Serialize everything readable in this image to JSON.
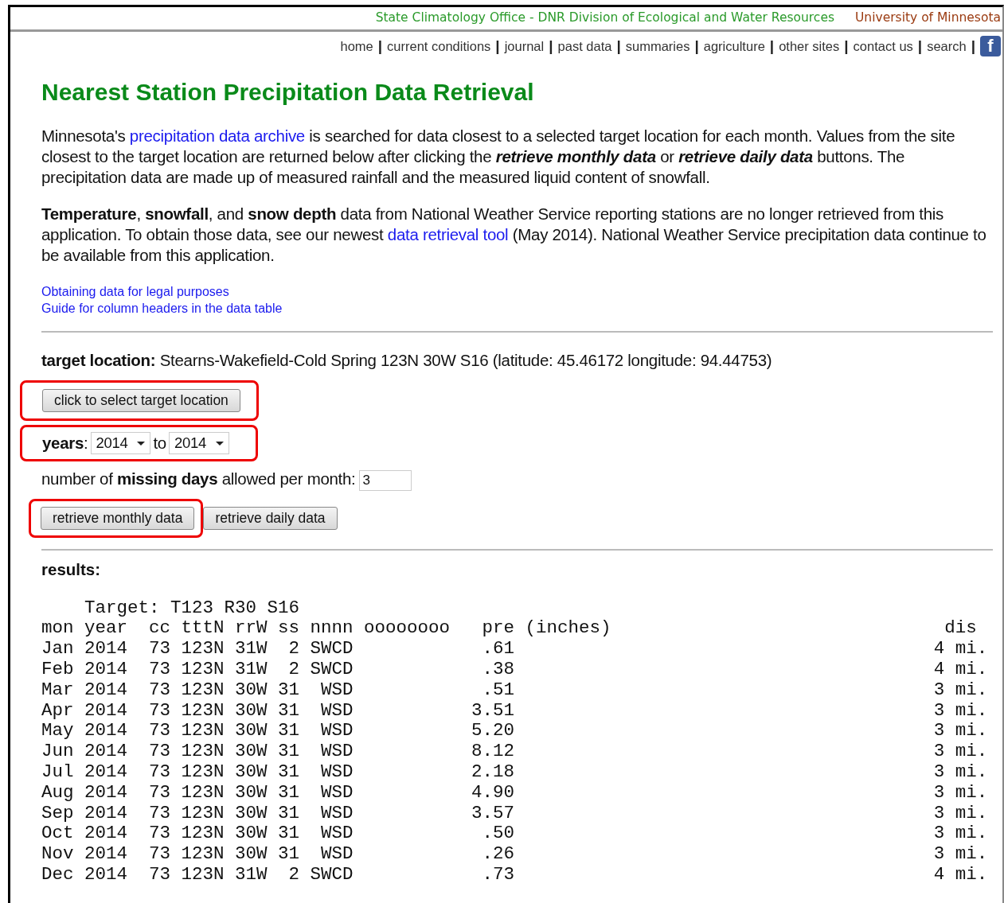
{
  "banner": {
    "office": "State Climatology Office - DNR Division of Ecological and Water Resources",
    "university": "University of Minnesota"
  },
  "nav": {
    "links": [
      "home",
      "current conditions",
      "journal",
      "past data",
      "summaries",
      "agriculture",
      "other sites",
      "contact us",
      "search"
    ],
    "separator": "|",
    "facebook": "f"
  },
  "title": "Nearest Station Precipitation Data Retrieval",
  "paragraphs": [
    [
      {
        "kind": "plain",
        "text": "Minnesota's "
      },
      {
        "kind": "link",
        "text": "precipitation data archive"
      },
      {
        "kind": "plain",
        "text": " is searched for data closest to a selected target location for each month. Values from the site closest to the target location are returned below after clicking the "
      },
      {
        "kind": "bolditalic",
        "text": "retrieve monthly data"
      },
      {
        "kind": "plain",
        "text": " or "
      },
      {
        "kind": "bolditalic",
        "text": "retrieve daily data"
      },
      {
        "kind": "plain",
        "text": " buttons. The precipitation data are made up of measured rainfall and the measured liquid content of snowfall."
      }
    ],
    [
      {
        "kind": "bold",
        "text": "Temperature"
      },
      {
        "kind": "plain",
        "text": ", "
      },
      {
        "kind": "bold",
        "text": "snowfall"
      },
      {
        "kind": "plain",
        "text": ", and "
      },
      {
        "kind": "bold",
        "text": "snow depth"
      },
      {
        "kind": "plain",
        "text": " data from National Weather Service reporting stations are no longer retrieved from this application. To obtain those data, see our newest "
      },
      {
        "kind": "link",
        "text": "data retrieval tool"
      },
      {
        "kind": "plain",
        "text": " (May 2014). National Weather Service precipitation data continue to be available from this application."
      }
    ]
  ],
  "small_links": [
    "Obtaining data for legal purposes",
    "Guide for column headers in the data table"
  ],
  "target": {
    "label": "target location:",
    "value": "Stearns-Wakefield-Cold Spring 123N 30W  S16 (latitude: 45.46172 longitude: 94.44753)"
  },
  "select_button": "click to select target location",
  "years": {
    "label": "years",
    "colon": ":",
    "from": "2014",
    "to_word": "to",
    "to": "2014"
  },
  "missing": {
    "segments": [
      {
        "kind": "plain",
        "text": "number of "
      },
      {
        "kind": "bold",
        "text": "missing days"
      },
      {
        "kind": "plain",
        "text": " allowed per month:"
      }
    ],
    "value": "3"
  },
  "buttons": [
    {
      "label": "retrieve monthly data",
      "highlighted": true
    },
    {
      "label": "retrieve daily data",
      "highlighted": false
    }
  ],
  "results": {
    "label": "results:",
    "target_line": "Target: T123 R30 S16",
    "columns": [
      "mon",
      "year",
      "cc",
      "tttN",
      "rrW",
      "ss",
      "nnnn",
      "oooooooo",
      "pre (inches)",
      "dis"
    ],
    "rows": [
      {
        "mon": "Jan",
        "year": "2014",
        "cc": "73",
        "ttt": "123N",
        "rr": "31W",
        "ss": "2",
        "nnnn": "SWCD",
        "pre": ".61",
        "dis": "4 mi."
      },
      {
        "mon": "Feb",
        "year": "2014",
        "cc": "73",
        "ttt": "123N",
        "rr": "31W",
        "ss": "2",
        "nnnn": "SWCD",
        "pre": ".38",
        "dis": "4 mi."
      },
      {
        "mon": "Mar",
        "year": "2014",
        "cc": "73",
        "ttt": "123N",
        "rr": "30W",
        "ss": "31",
        "nnnn": "WSD",
        "pre": ".51",
        "dis": "3 mi."
      },
      {
        "mon": "Apr",
        "year": "2014",
        "cc": "73",
        "ttt": "123N",
        "rr": "30W",
        "ss": "31",
        "nnnn": "WSD",
        "pre": "3.51",
        "dis": "3 mi."
      },
      {
        "mon": "May",
        "year": "2014",
        "cc": "73",
        "ttt": "123N",
        "rr": "30W",
        "ss": "31",
        "nnnn": "WSD",
        "pre": "5.20",
        "dis": "3 mi."
      },
      {
        "mon": "Jun",
        "year": "2014",
        "cc": "73",
        "ttt": "123N",
        "rr": "30W",
        "ss": "31",
        "nnnn": "WSD",
        "pre": "8.12",
        "dis": "3 mi."
      },
      {
        "mon": "Jul",
        "year": "2014",
        "cc": "73",
        "ttt": "123N",
        "rr": "30W",
        "ss": "31",
        "nnnn": "WSD",
        "pre": "2.18",
        "dis": "3 mi."
      },
      {
        "mon": "Aug",
        "year": "2014",
        "cc": "73",
        "ttt": "123N",
        "rr": "30W",
        "ss": "31",
        "nnnn": "WSD",
        "pre": "4.90",
        "dis": "3 mi."
      },
      {
        "mon": "Sep",
        "year": "2014",
        "cc": "73",
        "ttt": "123N",
        "rr": "30W",
        "ss": "31",
        "nnnn": "WSD",
        "pre": "3.57",
        "dis": "3 mi."
      },
      {
        "mon": "Oct",
        "year": "2014",
        "cc": "73",
        "ttt": "123N",
        "rr": "30W",
        "ss": "31",
        "nnnn": "WSD",
        "pre": ".50",
        "dis": "3 mi."
      },
      {
        "mon": "Nov",
        "year": "2014",
        "cc": "73",
        "ttt": "123N",
        "rr": "30W",
        "ss": "31",
        "nnnn": "WSD",
        "pre": ".26",
        "dis": "3 mi."
      },
      {
        "mon": "Dec",
        "year": "2014",
        "cc": "73",
        "ttt": "123N",
        "rr": "31W",
        "ss": "2",
        "nnnn": "SWCD",
        "pre": ".73",
        "dis": "4 mi."
      }
    ]
  }
}
